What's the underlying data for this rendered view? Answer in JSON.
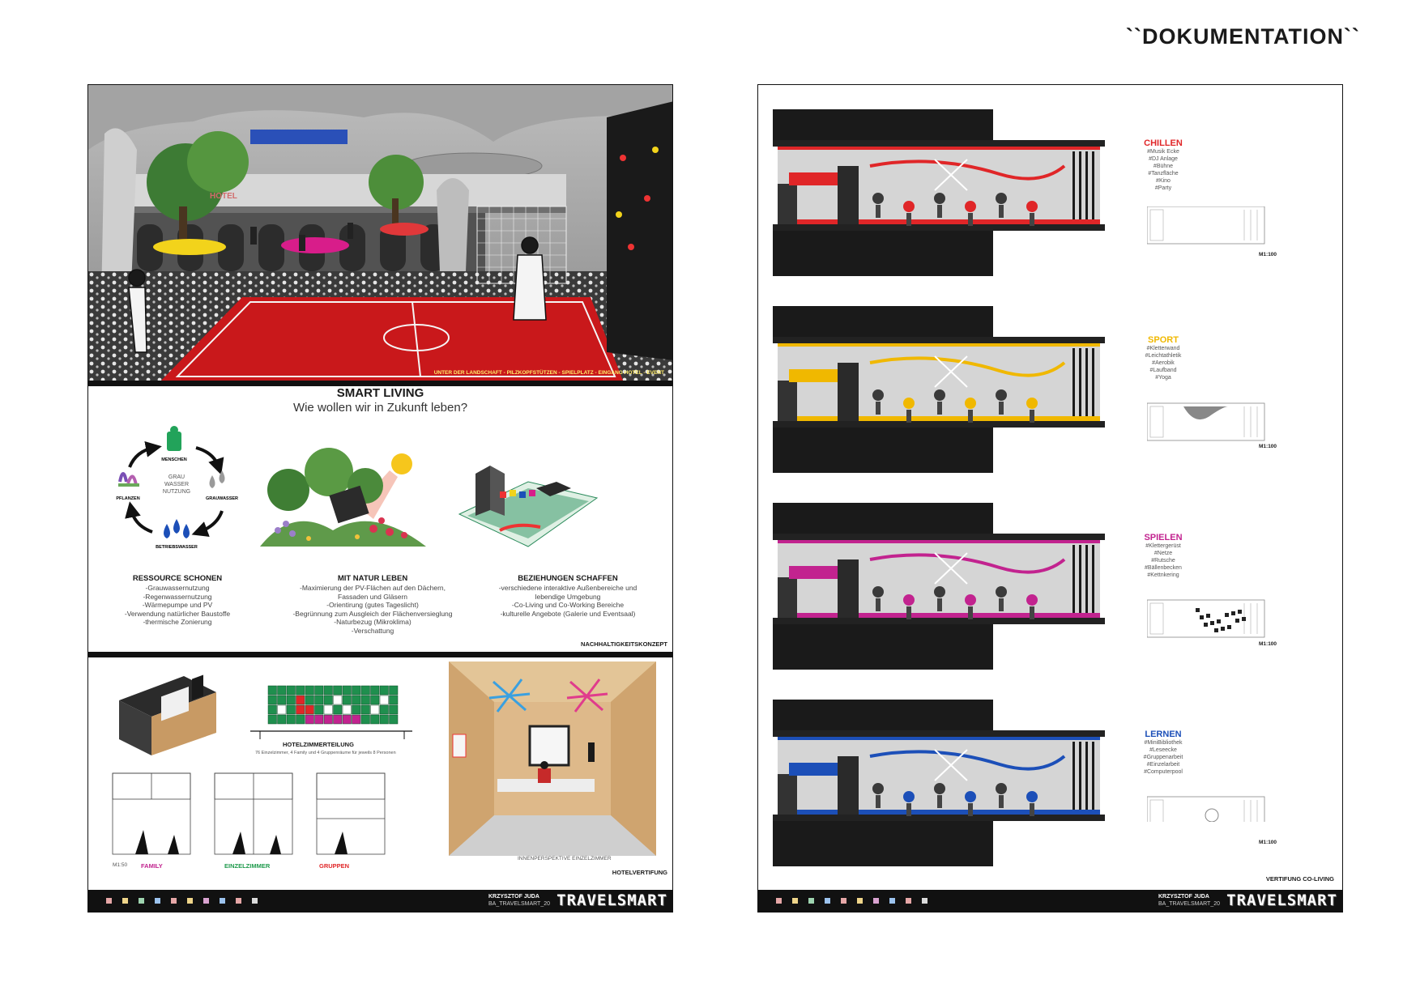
{
  "page": {
    "title": "``DOKUMENTATION``"
  },
  "colors": {
    "red": "#e02628",
    "yellow": "#f0b800",
    "magenta": "#c2238f",
    "blue": "#1c4fb8",
    "green": "#1f9a4c",
    "black": "#111111"
  },
  "left": {
    "hero_caption": "UNTER DER LANDSCHAFT - PILZKOPFSTÜTZEN - SPIELPLATZ - EINGANG HOTEL - EVENT",
    "hero_sign": "HOTEL",
    "smart_title": "SMART LIVING",
    "smart_subtitle": "Wie wollen wir in Zukunft leben?",
    "cycle": {
      "top": "MENSCHEN",
      "center_lines": [
        "GRAU",
        "WASSER",
        "NUTZUNG"
      ],
      "right": "GRAUWASSER",
      "bottom": "BETRIEBSWASSER",
      "left": "PFLANZEN"
    },
    "columns": [
      {
        "title": "RESSOURCE SCHONEN",
        "lines": [
          "-Grauwassernutzung",
          "-Regenwassernutzung",
          "-Wärmepumpe und PV",
          "-Verwendung natürlicher Baustoffe",
          "-thermische Zonierung"
        ]
      },
      {
        "title": "MIT NATUR LEBEN",
        "lines": [
          "-Maximierung der PV-Flächen auf den Dächern,",
          "Fassaden und Gläsern",
          "-Orientirung (gutes Tageslicht)",
          "-Begrünnung zum Ausgleich der Flächenversieglung",
          "-Naturbezug (Mikroklima)",
          "-Verschattung"
        ]
      },
      {
        "title": "BEZIEHUNGEN SCHAFFEN",
        "lines": [
          "-verschiedene interaktive Außenbereiche und",
          "lebendige Umgebung",
          "-Co-Living und Co-Working Bereiche",
          "-kulturelle Angebote (Galerie und Eventsaal)"
        ]
      }
    ],
    "concept_label": "NACHHALTIGKEITSKONZEPT",
    "hotel": {
      "division_title": "HOTELZIMMERTEILUNG",
      "division_sub": "76 Einzelzimmer, 4 Family und 4 Gruppenräume für jeweils 8 Personen",
      "scale": "M1:50",
      "plan_family": "FAMILY",
      "plan_single": "EINZELZIMMER",
      "plan_group": "GRUPPEN",
      "interior_caption": "INNENPERSPEKTIVE EINZELZIMMER",
      "section_label": "HOTELVERTIFUNG"
    }
  },
  "right": {
    "sections": [
      {
        "title": "CHILLEN",
        "tags": [
          "#Musik Ecke",
          "#DJ Anlage",
          "#Bühne",
          "#Tanzfläche",
          "#Kino",
          "#Party"
        ],
        "scale": "M1:100"
      },
      {
        "title": "SPORT",
        "tags": [
          "#Kletterwand",
          "#Leichtathletik",
          "#Aerobik",
          "#Laufband",
          "#Yoga"
        ],
        "scale": "M1:100"
      },
      {
        "title": "SPIELEN",
        "tags": [
          "#Klettergerüst",
          "#Netze",
          "#Rutsche",
          "#Bällenbecken",
          "#Kettnkering"
        ],
        "scale": "M1:100"
      },
      {
        "title": "LERNEN",
        "tags": [
          "#MiniBibliothek",
          "#Leseecke",
          "#Gruppenarbeit",
          "#Einzelarbeit",
          "#Computerpool"
        ],
        "scale": "M1:100"
      }
    ],
    "section_label": "VERTIFUNG CO-LIVING"
  },
  "footer": {
    "author": "KRZYSZTOF JUDA",
    "project": "BA_TRAVELSMART_20",
    "brand": "TRAVELSMART"
  }
}
